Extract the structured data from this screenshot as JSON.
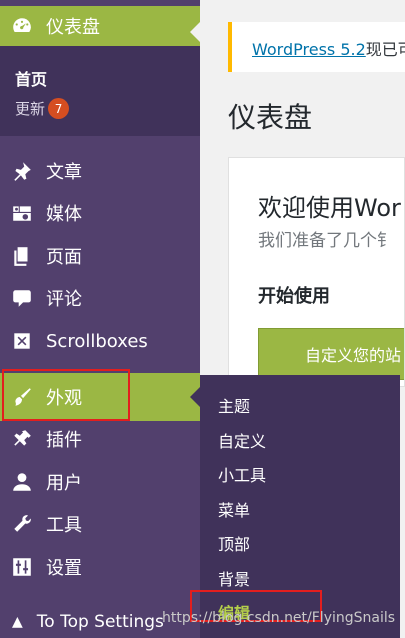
{
  "sidebar": {
    "dashboard": "仪表盘",
    "home": "首页",
    "updates": "更新",
    "updates_count": "7",
    "items": {
      "posts": "文章",
      "media": "媒体",
      "pages": "页面",
      "comments": "评论",
      "scrollboxes": "Scrollboxes",
      "appearance": "外观",
      "plugins": "插件",
      "users": "用户",
      "tools": "工具",
      "settings": "设置"
    },
    "totop": "To Top Settings"
  },
  "appearance_submenu": {
    "themes": "主题",
    "customize": "自定义",
    "widgets": "小工具",
    "menus": "菜单",
    "header": "顶部",
    "background": "背景",
    "editor": "编辑"
  },
  "main": {
    "notice_link": "WordPress 5.2",
    "notice_text": "现已可",
    "page_title": "仪表盘",
    "welcome_title": "欢迎使用Wor",
    "welcome_sub": "我们准备了几个钅",
    "get_started": "开始使用",
    "customize_button": "自定义您的站"
  },
  "watermark": "https://blog.csdn.net/FlyingSnails",
  "colors": {
    "sidebar_bg": "#52406d",
    "submenu_bg": "#40325a",
    "accent_green": "#9bb744",
    "badge_orange": "#d54e21",
    "notice_yellow": "#ffb900",
    "link_blue": "#0073aa",
    "highlight_red": "#e31e1e"
  }
}
